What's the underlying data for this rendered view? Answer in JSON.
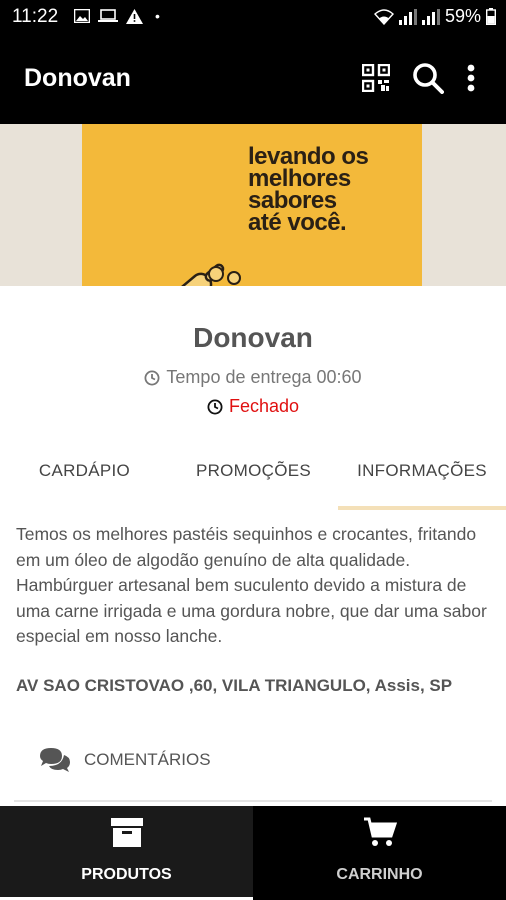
{
  "status_bar": {
    "time": "11:22",
    "battery": "59%"
  },
  "app_bar": {
    "title": "Donovan",
    "icons": [
      "qr-code-icon",
      "search-icon",
      "more-vert-icon"
    ]
  },
  "banner": {
    "slogan_lines": [
      "levando os",
      "melhores",
      "sabores",
      "até você."
    ]
  },
  "store": {
    "name": "Donovan",
    "delivery_time": "Tempo de entrega 00:60",
    "status": "Fechado"
  },
  "tabs": [
    {
      "label": "CARDÁPIO"
    },
    {
      "label": "PROMOÇÕES"
    },
    {
      "label": "INFORMAÇÕES",
      "active": true
    }
  ],
  "info": {
    "description": "Temos os melhores pastéis sequinhos e crocantes, fritando em um óleo de algodão genuíno de alta qualidade. Hambúrguer artesanal bem suculento devido a mistura de uma carne irrigada e uma gordura nobre, que dar uma sabor especial em nosso lanche.",
    "address": "AV SAO CRISTOVAO ,60, VILA TRIANGULO, Assis, SP",
    "comments_label": "COMENTÁRIOS"
  },
  "bottom_nav": [
    {
      "label": "PRODUTOS",
      "icon": "archive-icon",
      "active": true
    },
    {
      "label": "CARRINHO",
      "icon": "cart-icon"
    }
  ],
  "colors": {
    "closed": "#e01010",
    "tab_indicator": "#f4e0b8",
    "banner": "#f3b93a"
  }
}
